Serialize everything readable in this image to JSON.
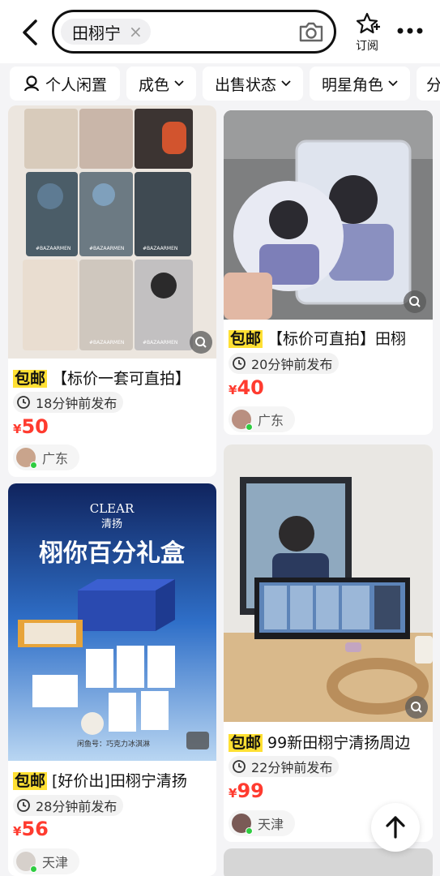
{
  "search": {
    "query": "田栩宁"
  },
  "header": {
    "subscribe_label": "订阅"
  },
  "filters": [
    {
      "label": "个人闲置"
    },
    {
      "label": "成色"
    },
    {
      "label": "出售状态"
    },
    {
      "label": "明星角色"
    },
    {
      "label": "分"
    }
  ],
  "items": [
    {
      "tag": "包邮",
      "title": "【标价一套可直拍】",
      "time": "18分钟前发布",
      "currency": "¥",
      "price": "50",
      "location": "广东",
      "watermark": "#BAZAARMEN"
    },
    {
      "tag": "包邮",
      "title": "【标价可直拍】田栩",
      "time": "20分钟前发布",
      "currency": "¥",
      "price": "40",
      "location": "广东"
    },
    {
      "tag": "包邮",
      "title": "[好价出]田栩宁清扬",
      "time": "28分钟前发布",
      "currency": "¥",
      "price": "56",
      "location": "天津",
      "brand_en": "CLEAR",
      "brand_cn": "清扬",
      "banner": "栩你百分礼盒",
      "footnote": "闲鱼号：巧克力冰淇淋"
    },
    {
      "tag": "包邮",
      "title": "99新田栩宁清扬周边",
      "time": "22分钟前发布",
      "currency": "¥",
      "price": "99",
      "location": "天津"
    }
  ],
  "colors": {
    "price": "#ff3b2f",
    "tag_bg": "#ffe033",
    "online": "#2ecc40"
  },
  "icons": [
    "back-arrow-icon",
    "camera-icon",
    "subscribe-star-icon",
    "more-icon",
    "person-icon",
    "chevron-down-icon",
    "clock-icon",
    "lens-icon",
    "arrow-up-icon"
  ]
}
